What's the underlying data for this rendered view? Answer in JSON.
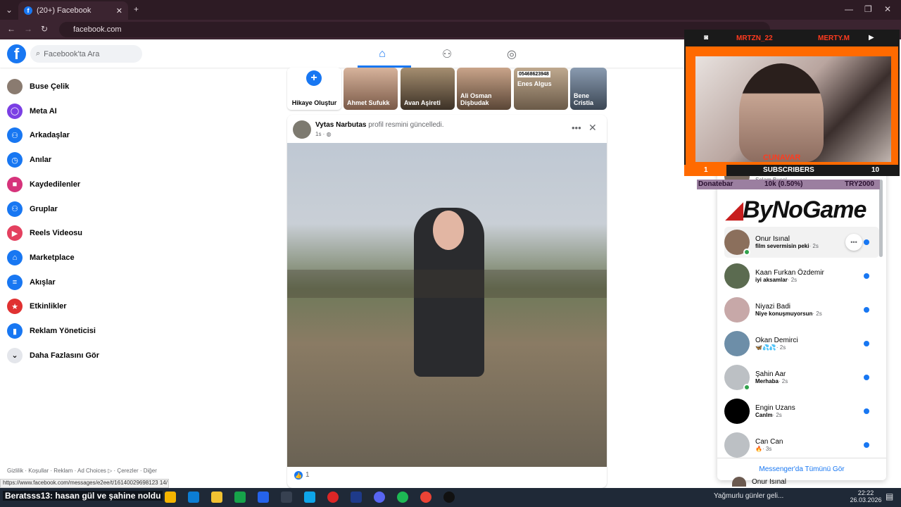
{
  "browser": {
    "tab_title": "(20+) Facebook",
    "url": "facebook.com",
    "status_url": "https://www.facebook.com/messages/e2ee/t/16140029698123 14/"
  },
  "fb": {
    "search_placeholder": "Facebook'ta Ara",
    "sidebar": [
      {
        "label": "Buse Çelik",
        "icon": "avatar"
      },
      {
        "label": "Meta AI",
        "icon": "meta-ai-icon"
      },
      {
        "label": "Arkadaşlar",
        "icon": "friends-icon"
      },
      {
        "label": "Anılar",
        "icon": "memories-icon"
      },
      {
        "label": "Kaydedilenler",
        "icon": "saved-icon"
      },
      {
        "label": "Gruplar",
        "icon": "groups-icon"
      },
      {
        "label": "Reels Videosu",
        "icon": "reels-icon"
      },
      {
        "label": "Marketplace",
        "icon": "marketplace-icon"
      },
      {
        "label": "Akışlar",
        "icon": "feeds-icon"
      },
      {
        "label": "Etkinlikler",
        "icon": "events-icon"
      },
      {
        "label": "Reklam Yöneticisi",
        "icon": "ads-manager-icon"
      },
      {
        "label": "Daha Fazlasını Gör",
        "icon": "chevron-down-icon"
      }
    ],
    "footer": "Gizlilik · Koşullar · Reklam · Ad Choices ▷ · Çerezler · Diğer",
    "stories": [
      {
        "label": "Hikaye Oluştur"
      },
      {
        "label": "Ahmet Sufukk"
      },
      {
        "label": "Avan Aşireti"
      },
      {
        "label": "Ali Osman Dişbudak"
      },
      {
        "label": "Enes Algus",
        "tag": "05468623948"
      },
      {
        "label": "Bene Cristia"
      }
    ],
    "post": {
      "author": "Vytas Narbutas",
      "action": "profil resmini güncelledi.",
      "time": "1s ·",
      "likes": "1"
    },
    "messenger": {
      "see_all": "Messenger'da Tümünü Gör",
      "chats": [
        {
          "name": "Onur Isınal",
          "preview": "film severmisin peki",
          "time": "· 2s",
          "online": true
        },
        {
          "name": "Kaan Furkan Özdemir",
          "preview": "iyi aksamlar",
          "time": "· 2s",
          "online": false
        },
        {
          "name": "Niyazi Badi",
          "preview": "Niye konuşmuyorsun",
          "time": "· 2s",
          "online": false
        },
        {
          "name": "Okan Demirci",
          "preview": "🦋💦💦",
          "time": "· 2s",
          "online": false
        },
        {
          "name": "Şahin Aar",
          "preview": "Merhaba",
          "time": "· 2s",
          "online": true
        },
        {
          "name": "Engin Uzans",
          "preview": "Canlm",
          "time": "· 2s",
          "online": false
        },
        {
          "name": "Can Can",
          "preview": "🔥",
          "time": "· 3s",
          "online": false
        }
      ],
      "partial_top": {
        "name": "Re",
        "preview": "Selam Bucol"
      },
      "bottom_name": "Onur Isınal"
    }
  },
  "overlay": {
    "left_handle": "MRTZN_22",
    "right_handle": "MERTY.M",
    "streamer": "CUNAVAR",
    "subs_label": "SUBSCRIBERS",
    "subs_left": "1",
    "subs_right": "10",
    "donate_label": "Donatebar",
    "donate_value": "10k (0.50%)",
    "donate_goal": "TRY2000",
    "logo_text": "ByNoGame"
  },
  "chat_overlay": "Beratsss13: hasan gül ve şahine noldu",
  "taskbar": {
    "weather": "Yağmurlu günler geli...",
    "time": "22:22",
    "date": "26.03.2026"
  }
}
